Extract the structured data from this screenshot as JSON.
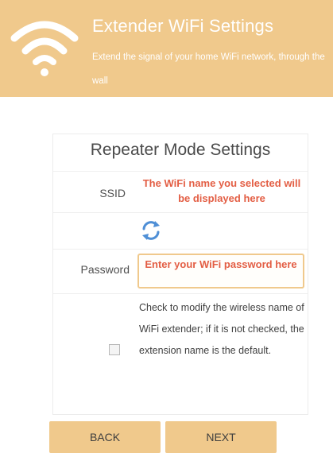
{
  "header": {
    "title": "Extender WiFi Settings",
    "subtitle": "Extend the signal of your home WiFi network, through the wall"
  },
  "form": {
    "title": "Repeater Mode Settings",
    "ssid_label": "SSID",
    "ssid_hint": "The WiFi name you selected will be displayed here",
    "password_label": "Password",
    "password_hint": "Enter your WiFi password here",
    "checkbox_text": "Check to modify the wireless name of WiFi extender; if it is not checked, the extension name is the default.",
    "checkbox_checked": false
  },
  "buttons": {
    "back": "BACK",
    "next": "NEXT"
  },
  "colors": {
    "accent": "#f0c98c",
    "hint": "#e35e44"
  },
  "icons": {
    "header": "wifi-icon",
    "ssid_action": "refresh-icon"
  }
}
